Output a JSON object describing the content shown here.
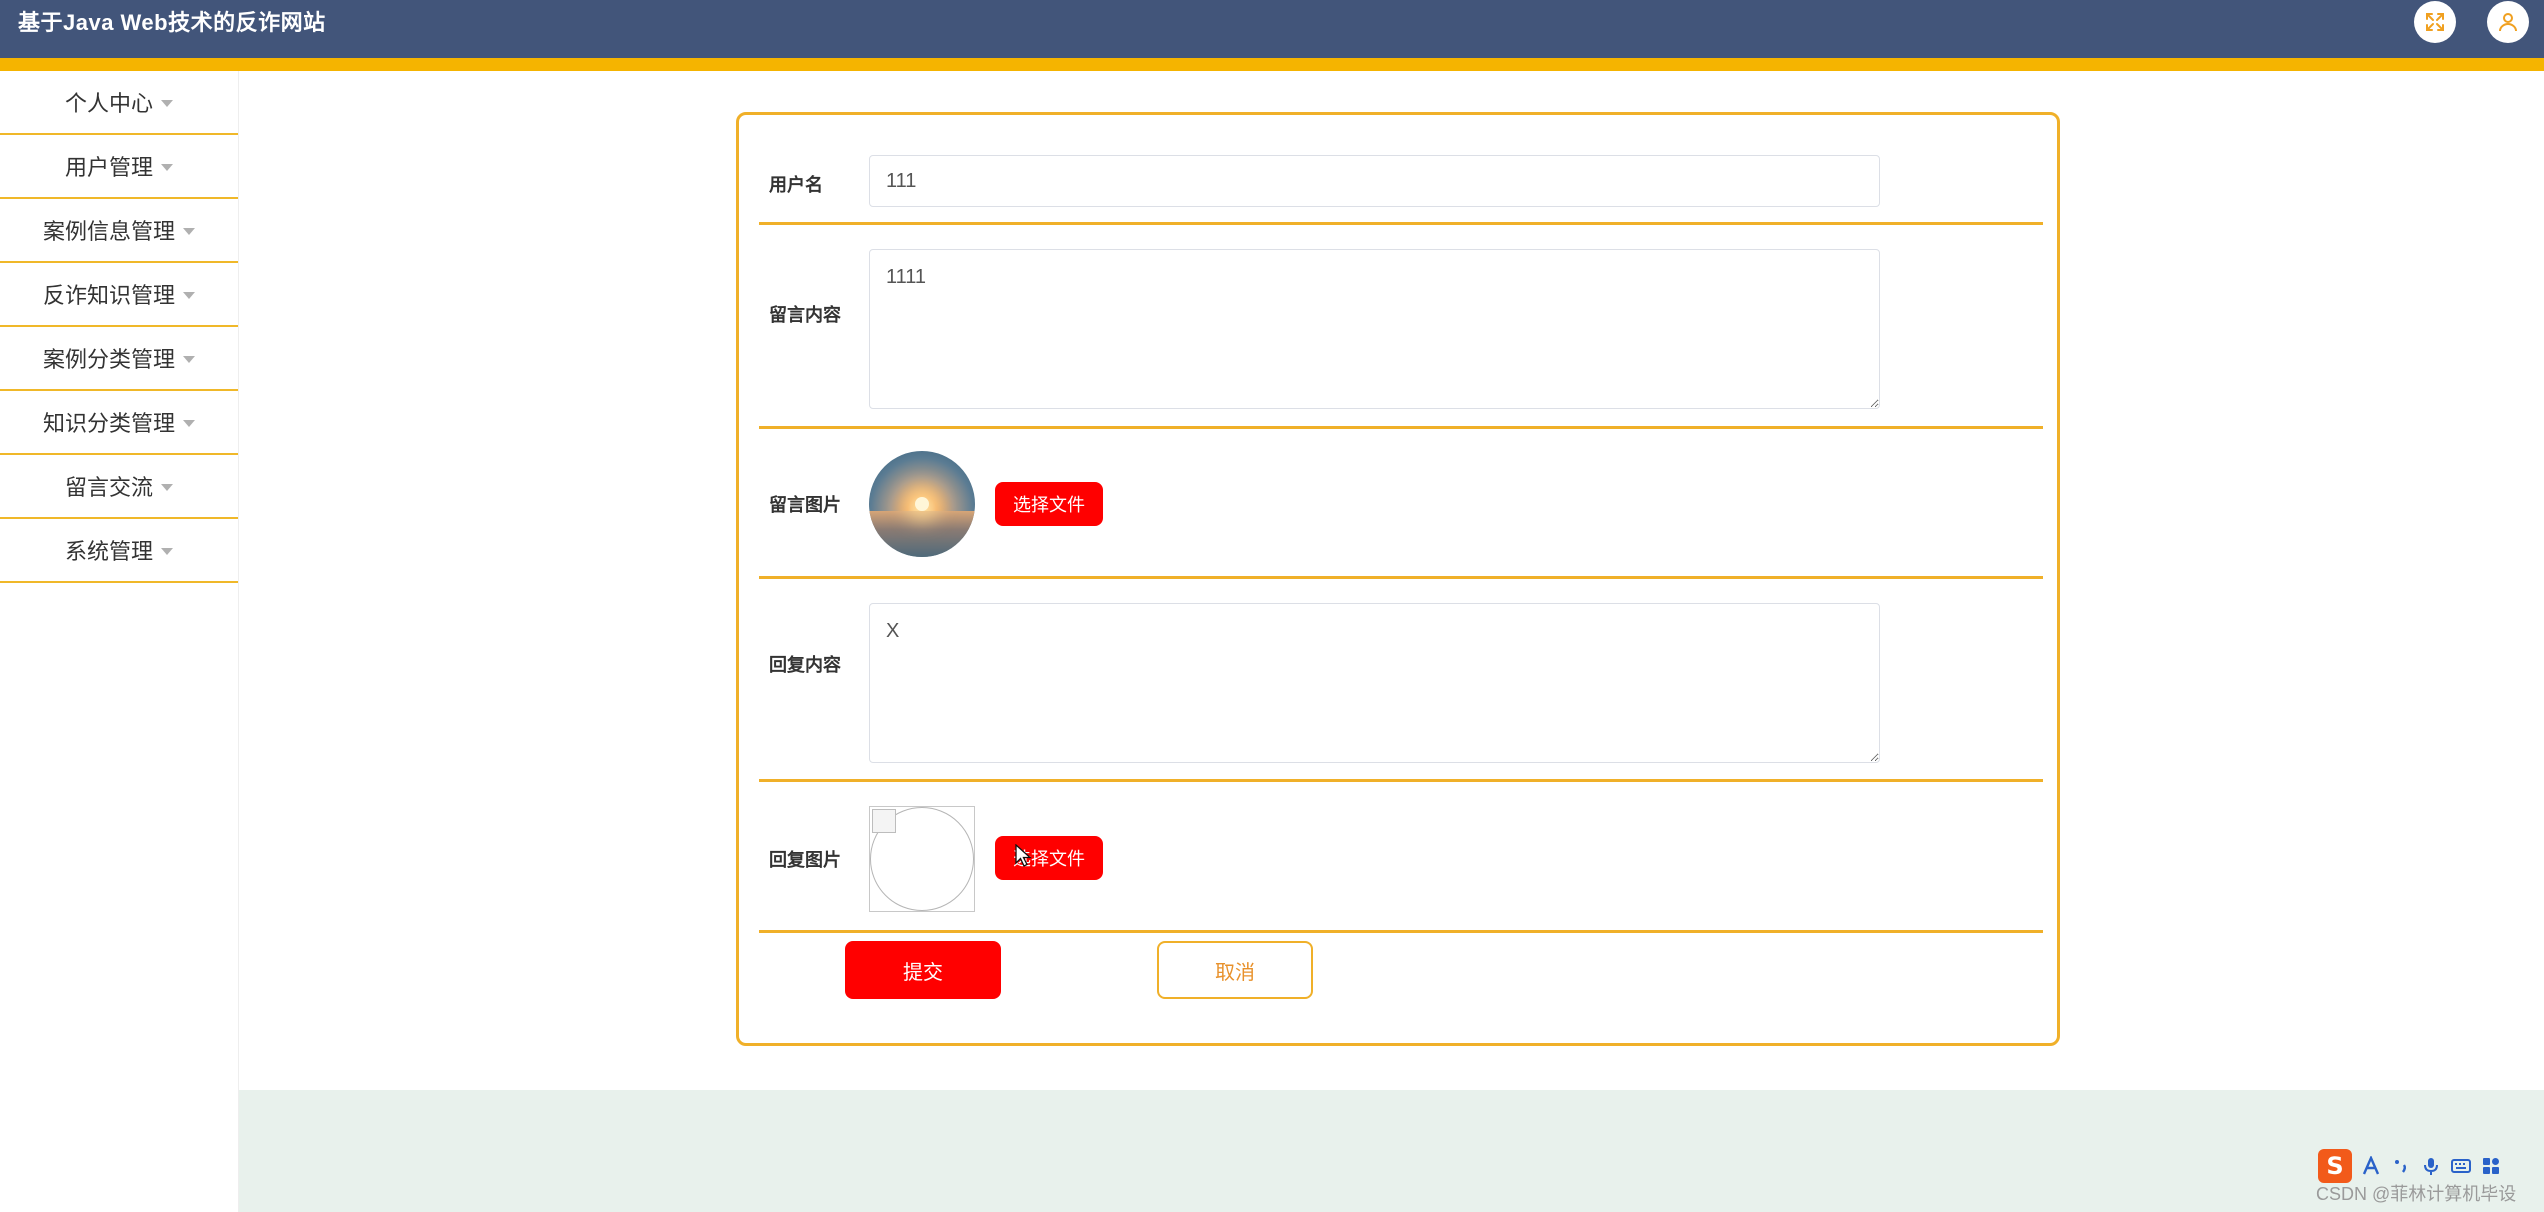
{
  "header": {
    "title": "基于Java Web技术的反诈网站",
    "fullscreen_icon": "fullscreen-icon",
    "user_icon": "user-icon"
  },
  "colors": {
    "header_bg": "#42557a",
    "accent_bar": "#f5b400",
    "border_accent": "#f0b029",
    "primary_button": "#ff0000",
    "content_bottom_bg": "#e8f1ec"
  },
  "sidebar": {
    "items": [
      {
        "label": "个人中心"
      },
      {
        "label": "用户管理"
      },
      {
        "label": "案例信息管理"
      },
      {
        "label": "反诈知识管理"
      },
      {
        "label": "案例分类管理"
      },
      {
        "label": "知识分类管理"
      },
      {
        "label": "留言交流"
      },
      {
        "label": "系统管理"
      }
    ]
  },
  "form": {
    "username": {
      "label": "用户名",
      "value": "111"
    },
    "message_content": {
      "label": "留言内容",
      "value": "1111"
    },
    "message_image": {
      "label": "留言图片",
      "button": "选择文件"
    },
    "reply_content": {
      "label": "回复内容",
      "value": "X"
    },
    "reply_image": {
      "label": "回复图片",
      "button": "选择文件"
    },
    "submit_label": "提交",
    "cancel_label": "取消"
  },
  "ime": {
    "logo": "S",
    "icons": [
      "ime-a-icon",
      "ime-punctuation-icon",
      "microphone-icon",
      "keyboard-icon",
      "grid-icon"
    ]
  },
  "watermark": "CSDN @菲林计算机毕设"
}
